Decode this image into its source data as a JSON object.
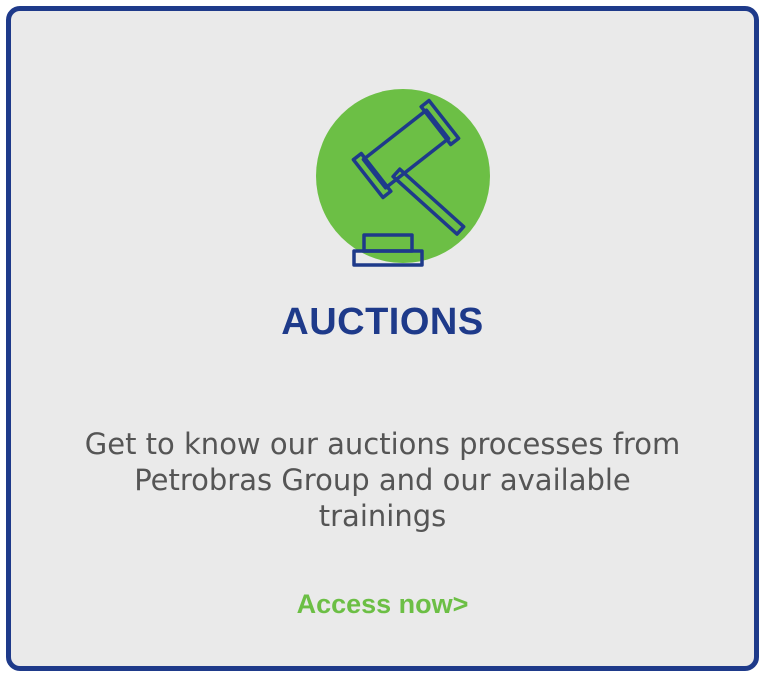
{
  "card": {
    "title": "AUCTIONS",
    "description": "Get to know our auctions processes from Petrobras Group and our available trainings",
    "cta_label": "Access now>"
  },
  "icon": {
    "name": "gavel-icon",
    "circle_color": "#6cbf45",
    "stroke_color": "#1e3a8a"
  },
  "colors": {
    "border": "#1e3a8a",
    "background": "#eaeaea",
    "title": "#1e3a8a",
    "text": "#555555",
    "cta": "#6cbf45"
  }
}
